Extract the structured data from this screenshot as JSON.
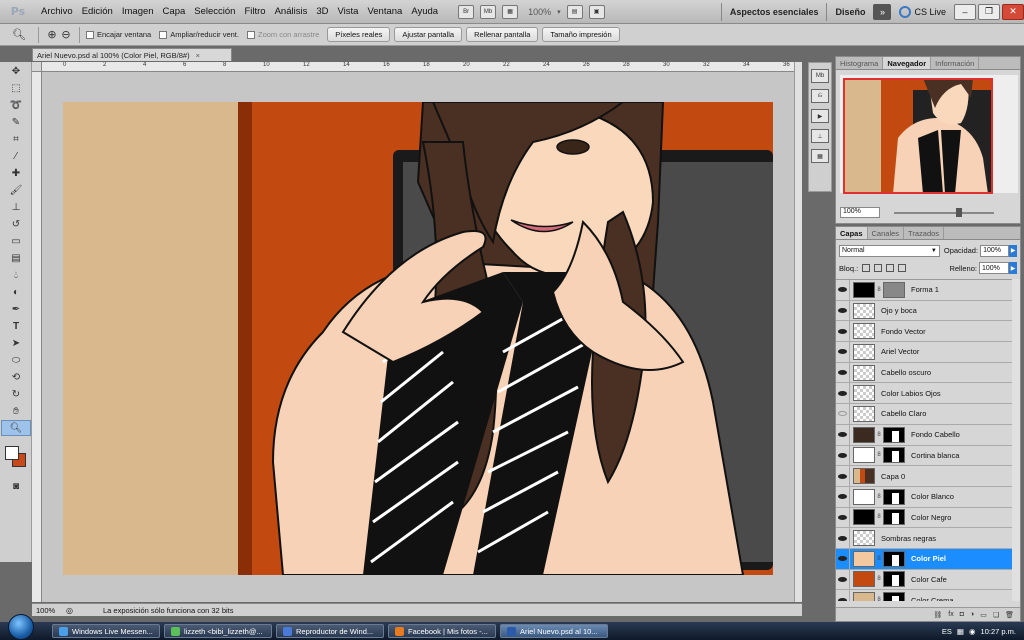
{
  "menu": {
    "items": [
      "Archivo",
      "Edición",
      "Imagen",
      "Capa",
      "Selección",
      "Filtro",
      "Análisis",
      "3D",
      "Vista",
      "Ventana",
      "Ayuda"
    ],
    "zoom": "100%",
    "workspace_active": "Aspectos esenciales",
    "workspace_other": "Diseño",
    "more": "»",
    "cs_live": "CS Live",
    "bridge": "Br",
    "minibridge": "Mb"
  },
  "options": {
    "checks": [
      "Encajar ventana",
      "Ampliar/reducir vent.",
      "Zoom con arrastre"
    ],
    "buttons": [
      "Píxeles reales",
      "Ajustar pantalla",
      "Rellenar pantalla",
      "Tamaño impresión"
    ]
  },
  "document": {
    "tab_title": "Ariel Nuevo.psd al 100% (Color Piel, RGB/8#)",
    "close": "×",
    "ruler_numbers": [
      "0",
      "2",
      "4",
      "6",
      "8",
      "10",
      "12",
      "14",
      "16",
      "18",
      "20",
      "22",
      "24",
      "26",
      "28",
      "30",
      "32",
      "34",
      "36"
    ],
    "status_zoom": "100%",
    "status_message": "La exposición sólo funciona con 32 bits"
  },
  "navigator": {
    "tabs": [
      "Histograma",
      "Navegador",
      "Información"
    ],
    "active_tab": "Navegador",
    "zoom": "100%"
  },
  "layers": {
    "tabs": [
      "Capas",
      "Canales",
      "Trazados"
    ],
    "blend_mode": "Normal",
    "opacity_label": "Opacidad:",
    "opacity": "100%",
    "lock_label": "Bloq.:",
    "fill_label": "Relleno:",
    "fill": "100%",
    "items": [
      {
        "name": "Forma 1",
        "visible": true,
        "thumb": "#000000",
        "mask": "gray"
      },
      {
        "name": "Ojo y boca",
        "visible": true,
        "thumb": "checker"
      },
      {
        "name": "Fondo Vector",
        "visible": true,
        "thumb": "checker"
      },
      {
        "name": "Ariel Vector",
        "visible": true,
        "thumb": "checker"
      },
      {
        "name": "Cabello oscuro",
        "visible": true,
        "thumb": "checker"
      },
      {
        "name": "Color Labios Ojos",
        "visible": true,
        "thumb": "checker"
      },
      {
        "name": "Cabello Claro",
        "visible": false,
        "thumb": "checker"
      },
      {
        "name": "Fondo Cabello",
        "visible": true,
        "thumb": "#3b2a20",
        "mask": "black"
      },
      {
        "name": "Cortina blanca",
        "visible": true,
        "thumb": "#ffffff",
        "mask": "black"
      },
      {
        "name": "Capa 0",
        "visible": true,
        "thumb": "photo"
      },
      {
        "name": "Color Blanco",
        "visible": true,
        "thumb": "#ffffff",
        "mask": "black"
      },
      {
        "name": "Color Negro",
        "visible": true,
        "thumb": "#000000",
        "mask": "black"
      },
      {
        "name": "Sombras negras",
        "visible": true,
        "thumb": "checker"
      },
      {
        "name": "Color Piel",
        "visible": true,
        "thumb": "#f5c9a0",
        "mask": "black",
        "selected": true
      },
      {
        "name": "Color Cafe",
        "visible": true,
        "thumb": "#c24a10",
        "mask": "black"
      },
      {
        "name": "Color Crema",
        "visible": true,
        "thumb": "#d9b88e",
        "mask": "black"
      }
    ]
  },
  "taskbar": {
    "items": [
      {
        "label": "Windows Live Messen...",
        "color": "#4aa0e8"
      },
      {
        "label": "lizzeth <bibi_lizzeth@...",
        "color": "#5ac05a"
      },
      {
        "label": "Reproductor de Wind...",
        "color": "#4a7ad8"
      },
      {
        "label": "Facebook | Mis fotos -...",
        "color": "#e87a20"
      },
      {
        "label": "Ariel Nuevo.psd al 10...",
        "color": "#2a5aa8",
        "active": true
      }
    ],
    "lang": "ES",
    "time": "10:27 p.m."
  },
  "colors": {
    "selection": "#1b8dff",
    "foreground": "#ffffff",
    "background": "#c84a1a"
  }
}
